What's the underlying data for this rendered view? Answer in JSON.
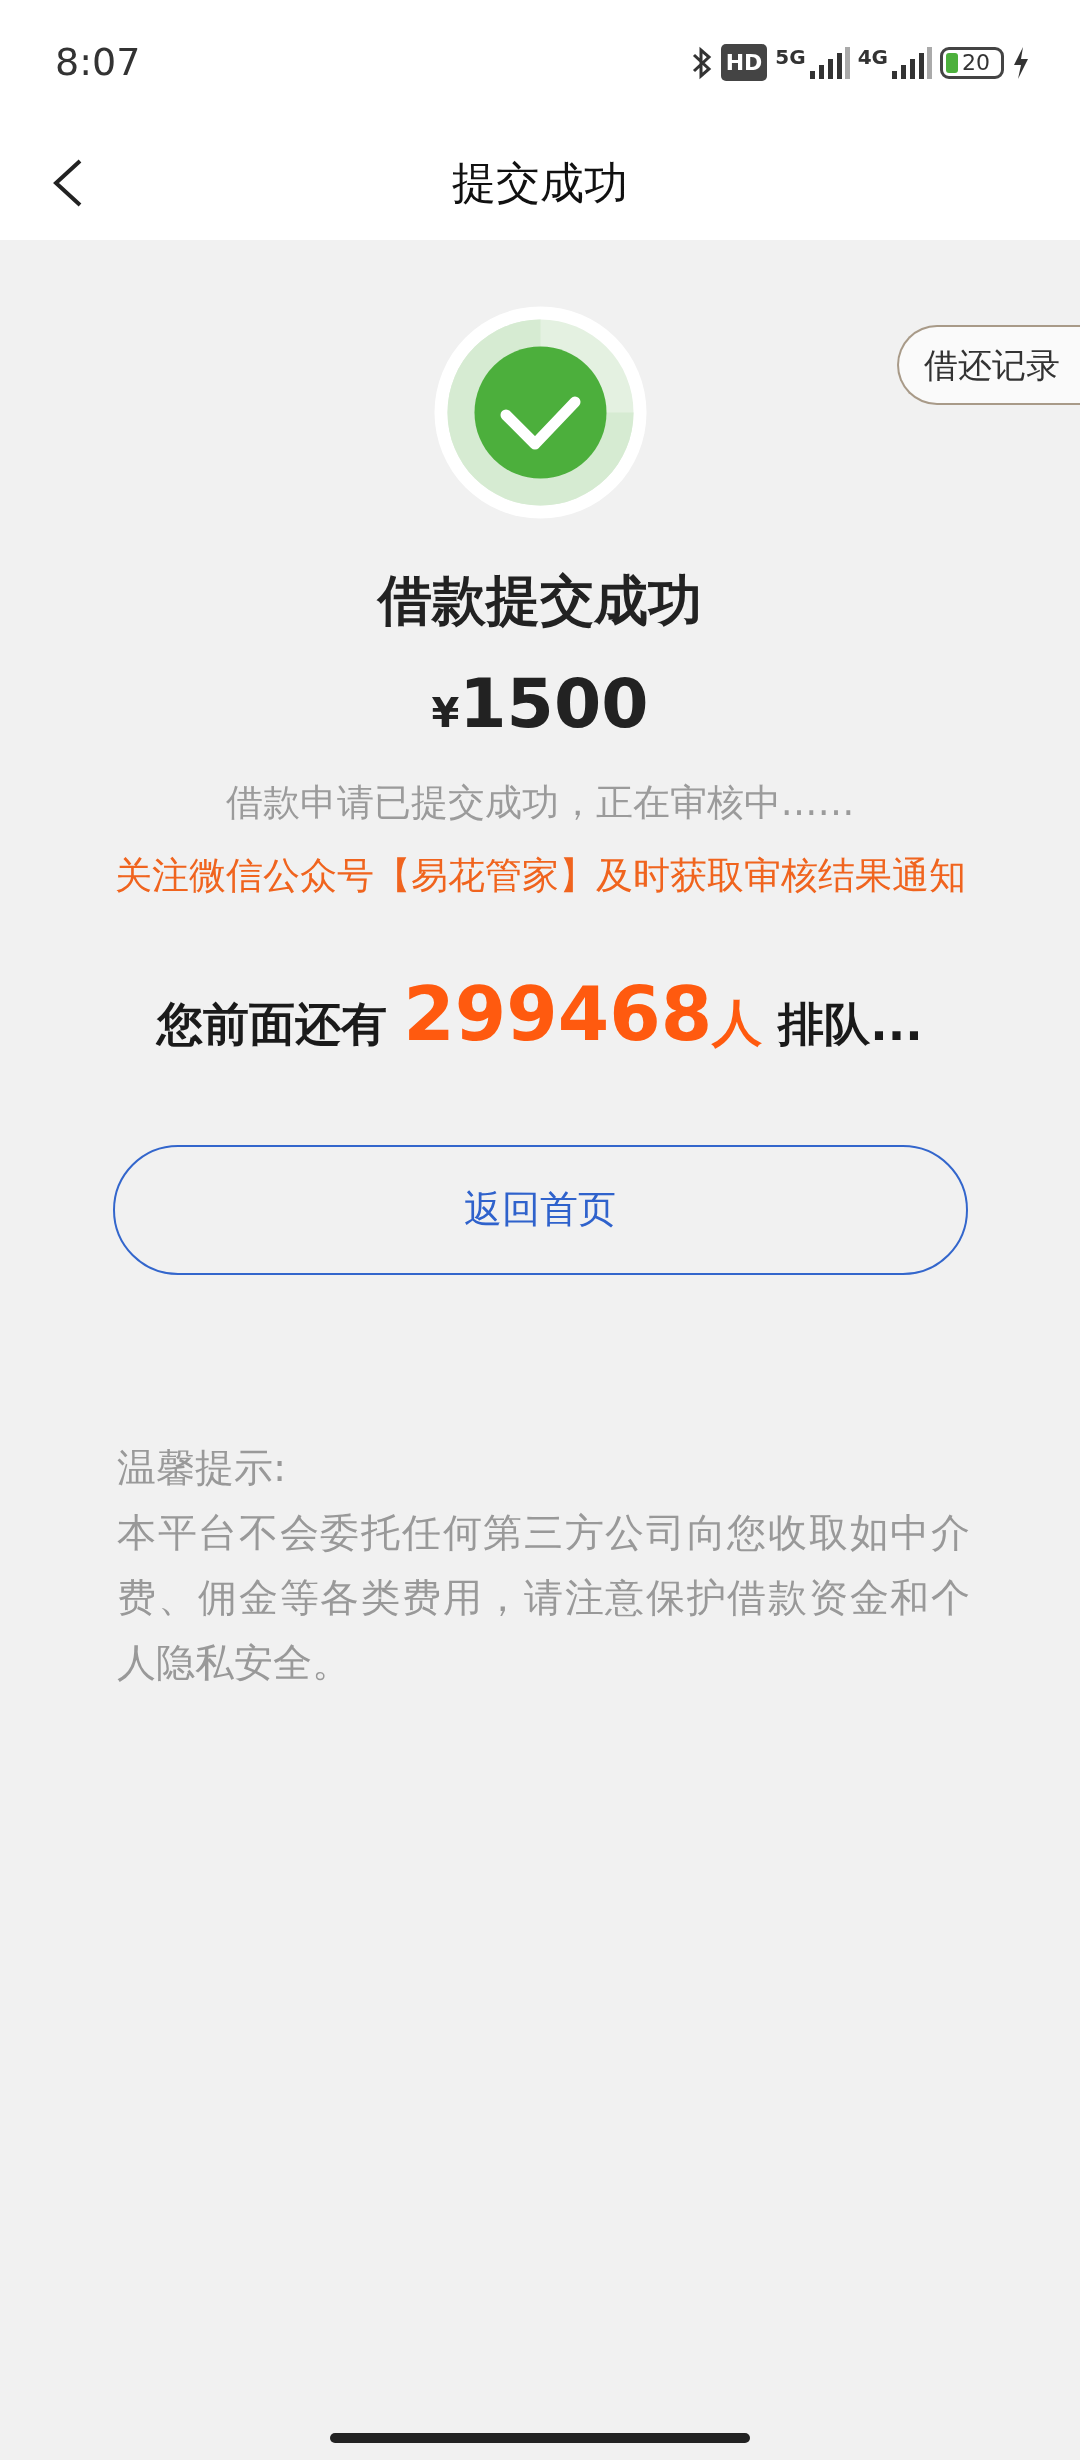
{
  "status_bar": {
    "time": "8:07",
    "hd": "HD",
    "network_1": "5G",
    "network_2": "4G",
    "battery": "20"
  },
  "header": {
    "title": "提交成功"
  },
  "records_button": "借还记录",
  "result": {
    "title": "借款提交成功",
    "currency": "¥",
    "amount": "1500",
    "status": "借款申请已提交成功，正在审核中……",
    "notice": "关注微信公众号【易花管家】及时获取审核结果通知"
  },
  "queue": {
    "prefix": "您前面还有",
    "count": "299468",
    "unit": "人",
    "suffix": "排队..."
  },
  "home_button": "返回首页",
  "tips": {
    "title": "温馨提示:",
    "body": "本平台不会委托任何第三方公司向您收取如中介费、佣金等各类费用，请注意保护借款资金和个人隐私安全。"
  }
}
